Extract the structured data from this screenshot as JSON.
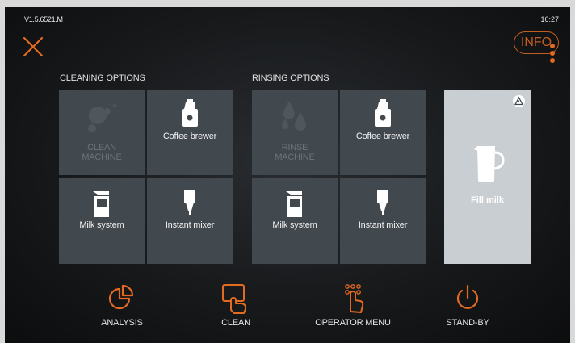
{
  "status": {
    "version": "V1.5.6521.M",
    "time": "16:27"
  },
  "header": {
    "info_label": "INFO"
  },
  "cleaning": {
    "title": "CLEANING OPTIONS",
    "tiles": [
      {
        "label": "CLEAN\nMACHINE",
        "enabled": false
      },
      {
        "label": "Coffee brewer",
        "enabled": true
      },
      {
        "label": "Milk system",
        "enabled": true
      },
      {
        "label": "Instant mixer",
        "enabled": true
      }
    ]
  },
  "rinsing": {
    "title": "RINSING OPTIONS",
    "tiles": [
      {
        "label": "RINSE\nMACHINE",
        "enabled": false
      },
      {
        "label": "Coffee brewer",
        "enabled": true
      },
      {
        "label": "Milk system",
        "enabled": true
      },
      {
        "label": "Instant mixer",
        "enabled": true
      }
    ]
  },
  "fill_milk": {
    "label": "Fill milk"
  },
  "nav": [
    {
      "label": "ANALYSIS",
      "icon": "analysis-pie-icon"
    },
    {
      "label": "CLEAN",
      "icon": "clean-hand-icon"
    },
    {
      "label": "OPERATOR MENU",
      "icon": "operator-keypad-icon"
    },
    {
      "label": "STAND-BY",
      "icon": "power-icon"
    }
  ],
  "colors": {
    "accent": "#e36a1f",
    "tile": "#41484e",
    "tile_active": "#c9ced2",
    "background": "#17191b"
  }
}
